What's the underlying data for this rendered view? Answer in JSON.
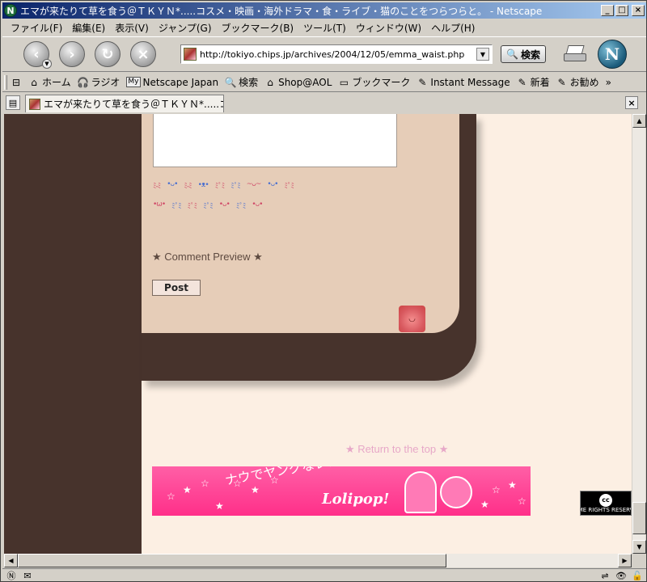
{
  "window": {
    "title": "エマが来たりて草を食う＠ＴＫＹＮ*.....コスメ・映画・海外ドラマ・食・ライブ・猫のことをつらつらと。 - Netscape",
    "app_icon": "N",
    "minimize": "_",
    "maximize": "□",
    "close": "×"
  },
  "menu": {
    "items": [
      "ファイル(F)",
      "編集(E)",
      "表示(V)",
      "ジャンプ(G)",
      "ブックマーク(B)",
      "ツール(T)",
      "ウィンドウ(W)",
      "ヘルプ(H)"
    ]
  },
  "nav": {
    "url": "http://tokiyo.chips.jp/archives/2004/12/05/emma_waist.php",
    "search_label": "検索",
    "back_glyph": "‹",
    "forward_glyph": "›",
    "reload_glyph": "↻",
    "stop_glyph": "×",
    "logo": "N"
  },
  "personal_toolbar": {
    "home": "ホーム",
    "radio": "ラジオ",
    "my_badge": "My",
    "netscape_japan": "Netscape Japan",
    "search": "検索",
    "shop": "Shop@AOL",
    "bookmarks": "ブックマーク",
    "instant_message": "Instant Message",
    "new_arrivals": "新着",
    "recommended": "お勧め",
    "more": "»"
  },
  "tabs": {
    "active_label": "エマが来たりて草を食う＠ＴＫＹＮ*.....コスメ...",
    "close_glyph": "×"
  },
  "page": {
    "emoji_row1": [
      "ﾐ-ﾐ",
      "•ᴗ•",
      "ﾐ-ﾐ",
      "•ᴥ•",
      "ﾐﾟﾐ",
      "ﾐﾟﾐ",
      "~ᴗ~",
      "•ᴗ•",
      "ﾐﾟﾐ"
    ],
    "emoji_row2": [
      "•ω•",
      "ﾐﾟﾐ",
      "ﾐﾟﾐ",
      "ﾐﾟﾐ",
      "•ᴗ•",
      "ﾐﾟﾐ",
      "•ᴗ•"
    ],
    "comment_preview": "★ Comment Preview ★",
    "post_label": "Post",
    "return_to_top": "★ Return to the top ★",
    "banner_text": "ナウでヤングなレンタルサーバー",
    "banner_logo": "Lolipop!",
    "cc_label": "SOME RIGHTS RESERVED",
    "cc_mark": "cc"
  },
  "colors": {
    "dark_brown": "#47332c",
    "panel": "#e6cdb8",
    "page_bg": "#fcefe3",
    "accent_pink": "#ff3d94"
  }
}
